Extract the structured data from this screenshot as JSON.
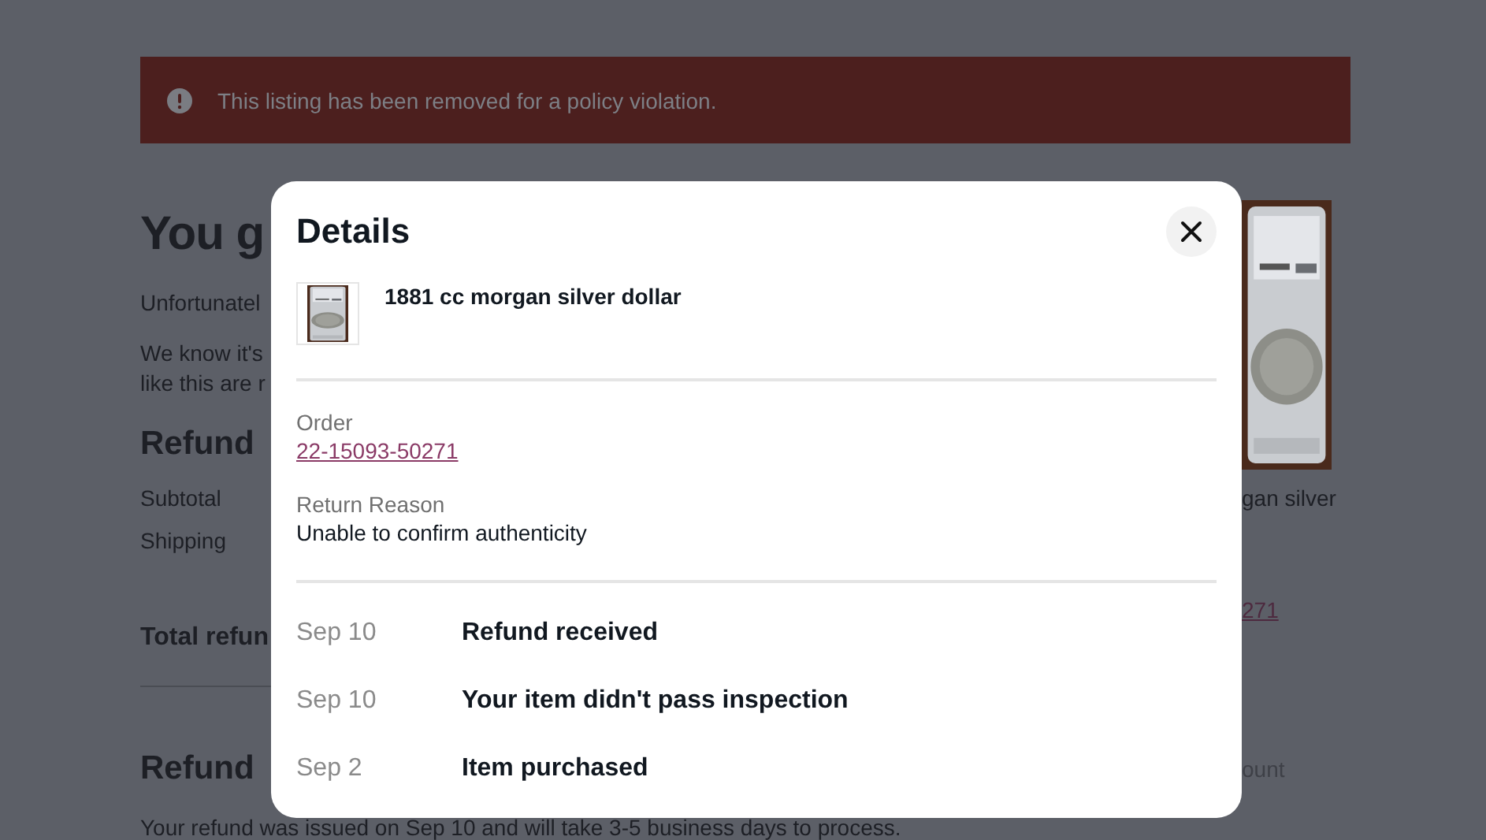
{
  "banner": {
    "message": "This listing has been removed for a policy violation."
  },
  "page": {
    "heading": "You g",
    "paragraphs": [
      "Unfortunatel",
      "We know it's\nlike this are r"
    ],
    "refund_summary": {
      "heading": "Refund",
      "rows": [
        "Subtotal",
        "Shipping"
      ],
      "total_label": "Total refun"
    },
    "refund_method": {
      "heading": "Refund",
      "text": "Your refund was issued on Sep 10 and will take 3-5 business days to process."
    }
  },
  "side": {
    "title": "gan silver",
    "order_link": "271",
    "column_3": "ount"
  },
  "dialog": {
    "title": "Details",
    "item": {
      "name": "1881 cc morgan silver dollar"
    },
    "order_label": "Order",
    "order_number": "22-15093-50271",
    "reason_label": "Return Reason",
    "reason": "Unable to confirm authenticity",
    "timeline": [
      {
        "date": "Sep 10",
        "event": "Refund received"
      },
      {
        "date": "Sep 10",
        "event": "Your item didn't pass inspection"
      },
      {
        "date": "Sep 2",
        "event": "Item purchased"
      }
    ]
  }
}
